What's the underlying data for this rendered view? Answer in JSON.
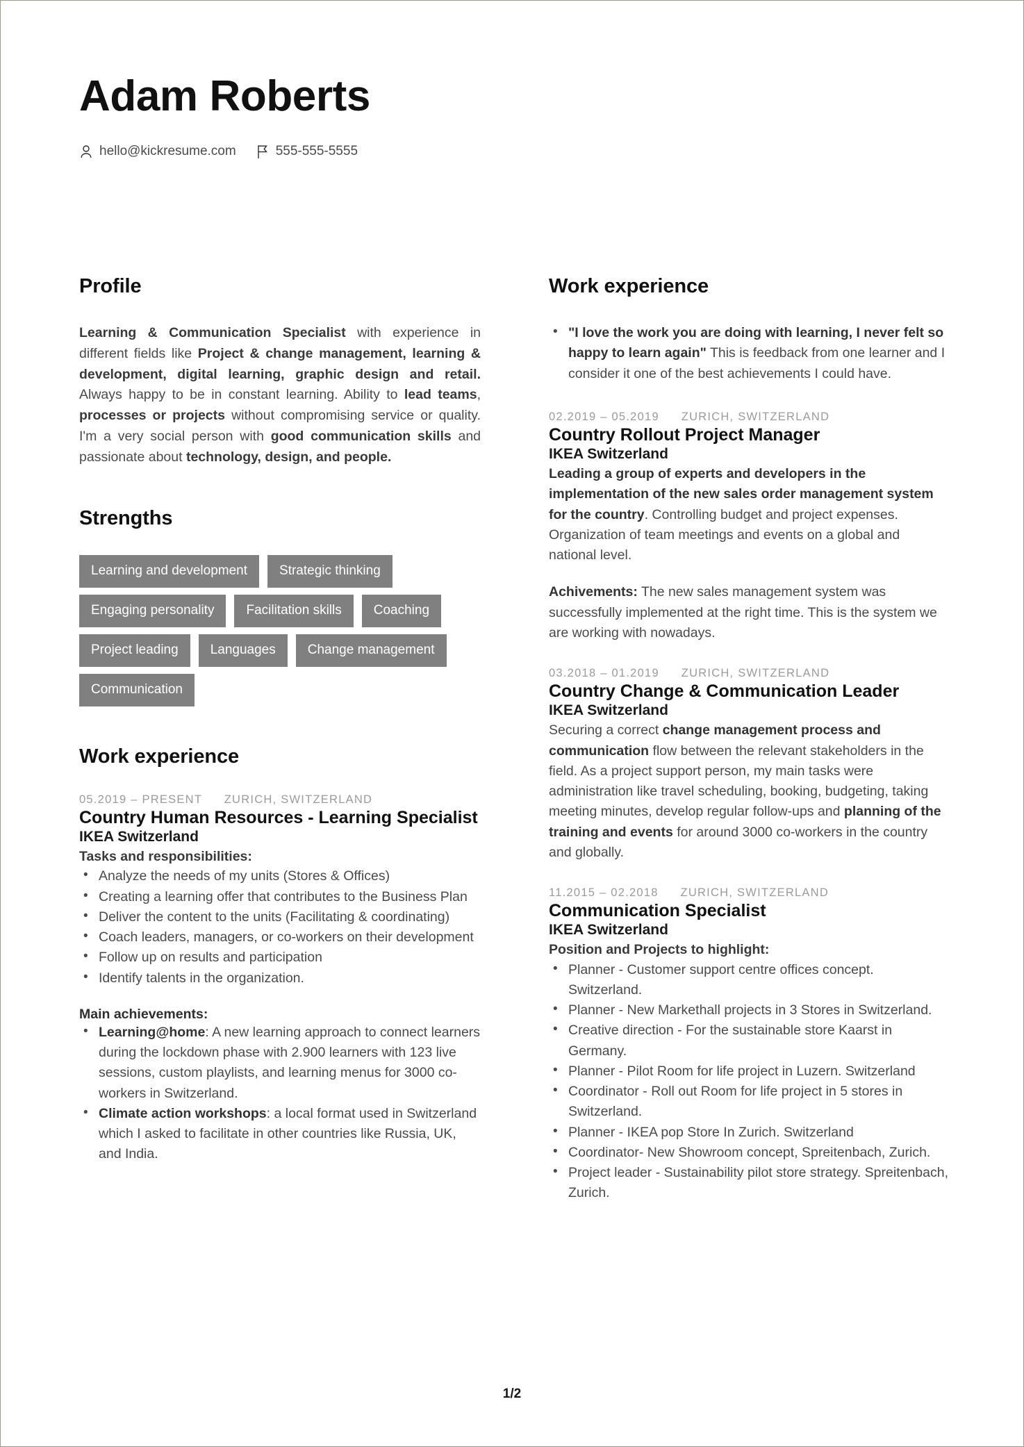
{
  "document": {
    "page_label": "1/2",
    "accent_tag_color": "#808080"
  },
  "header": {
    "name": "Adam Roberts",
    "contacts": [
      {
        "icon": "person-icon",
        "value": "hello@kickresume.com"
      },
      {
        "icon": "flag-icon",
        "value": "555-555-5555"
      }
    ]
  },
  "left_column": {
    "profile": {
      "heading": "Profile",
      "paragraph_html": "<b>Learning &amp; Communication Specialist</b> with experience in different fields like <b>Project &amp; change management, learning &amp; development, digital learning, graphic design and retail.</b> Always happy to be in constant learning. Ability to <b>lead teams</b>, <b>processes or projects</b> without compromising service or quality. I'm a very social person with <b>good communication skills</b> and passionate about <b>technology, design, and people.</b>"
    },
    "strengths": {
      "heading": "Strengths",
      "tags": [
        "Learning and development",
        "Strategic thinking",
        "Engaging personality",
        "Facilitation skills",
        "Coaching",
        "Project leading",
        "Languages",
        "Change management",
        "Communication"
      ]
    },
    "work_experience": {
      "heading": "Work experience",
      "jobs": [
        {
          "dates": "05.2019 – PRESENT",
          "location": "ZURICH, SWITZERLAND",
          "title": "Country Human Resources - Learning Specialist",
          "company": "IKEA Switzerland",
          "subheading": "Tasks and responsibilities:",
          "bullets": [
            "Analyze the needs of my units (Stores &amp; Offices)",
            "Creating a learning offer that contributes to the Business Plan",
            "Deliver the content to the units (Facilitating &amp; coordinating)",
            "Coach leaders, managers, or co-workers on their development",
            "Follow up on results and participation",
            "Identify talents in the organization."
          ],
          "achievements_heading": "Main achievements:",
          "achievements": [
            "<b>Learning@home</b>: A new learning approach to connect learners during the lockdown phase with 2.900 learners with 123 live sessions, custom playlists, and learning menus for 3000 co-workers in Switzerland.",
            "<b>Climate action workshops</b>: a local format used in Switzerland which I asked to facilitate in other countries like Russia, UK, and India."
          ]
        }
      ]
    }
  },
  "right_column": {
    "work_experience": {
      "heading": "Work experience",
      "intro_bullets": [
        "<b>\"I love the work you are doing with learning, I never felt so happy to learn again\"</b> This is feedback from one learner and I consider it one of the best achievements I could have."
      ],
      "jobs": [
        {
          "dates": "02.2019 – 05.2019",
          "location": "ZURICH, SWITZERLAND",
          "title": "Country Rollout Project Manager",
          "company": "IKEA Switzerland",
          "description_html": "<b>Leading a group of experts and developers in the implementation of the new sales order management system for the country</b>. Controlling budget and project expenses. Organization of team meetings and events on a global and national level.",
          "secondary_html": "<b>Achivements:</b> The new sales management system was successfully implemented at the right time. This is the system we are working with nowadays."
        },
        {
          "dates": "03.2018 – 01.2019",
          "location": "ZURICH, SWITZERLAND",
          "title": "Country Change &amp; Communication Leader",
          "company": "IKEA Switzerland",
          "description_html": "Securing a correct <b>change management process and communication</b> flow between the relevant stakeholders in the field. As a project support person, my main tasks were administration like travel scheduling, booking, budgeting, taking meeting minutes, develop regular follow-ups and <b>planning of the training and events</b> for around 3000 co-workers in the country and globally."
        },
        {
          "dates": "11.2015 – 02.2018",
          "location": "ZURICH, SWITZERLAND",
          "title": "Communication Specialist",
          "company": "IKEA Switzerland",
          "subheading": "Position and Projects to highlight:",
          "bullets": [
            "Planner - Customer support centre offices concept. Switzerland.",
            "Planner - New Markethall projects in 3 Stores in Switzerland.",
            "Creative direction - For the sustainable store Kaarst in Germany.",
            "Planner - Pilot Room for life project in Luzern. Switzerland",
            "Coordinator - Roll out Room for life project in 5 stores in Switzerland.",
            "Planner - IKEA pop Store In Zurich. Switzerland",
            "Coordinator- New Showroom concept, Spreitenbach, Zurich.",
            "Project leader - Sustainability pilot store strategy. Spreitenbach, Zurich."
          ]
        }
      ]
    }
  }
}
